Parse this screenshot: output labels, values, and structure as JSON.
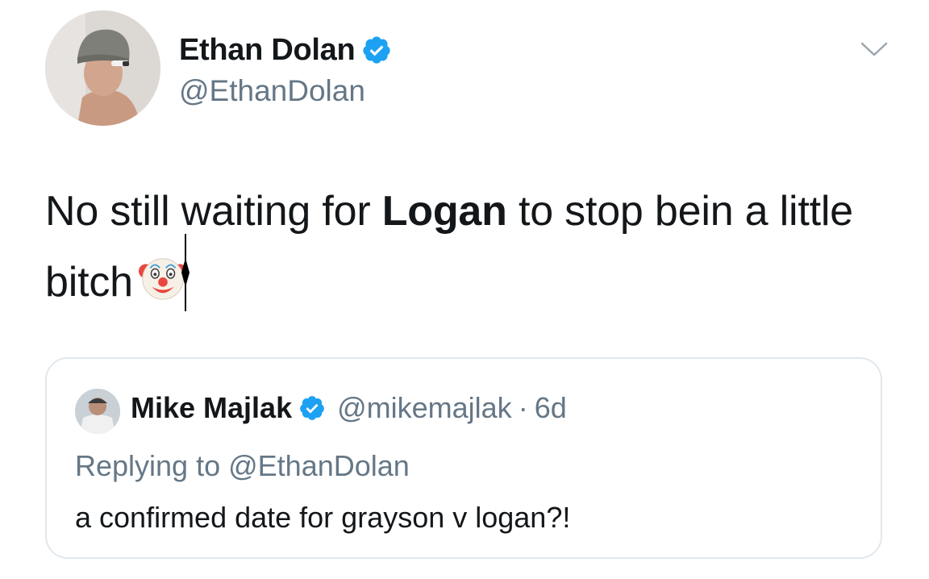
{
  "author": {
    "display_name": "Ethan Dolan",
    "handle": "@EthanDolan",
    "verified": true,
    "avatar_icon": "avatar-photo"
  },
  "menu": {
    "icon": "chevron-down-icon"
  },
  "tweet": {
    "text_before": "No still waiting for ",
    "text_bold": "Logan",
    "text_after": " to stop bein a little bitch",
    "emoji": "clown-face-icon"
  },
  "quoted": {
    "display_name": "Mike Majlak",
    "handle": "@mikemajlak",
    "separator": "·",
    "time": "6d",
    "replying_to": "Replying to @EthanDolan",
    "text": "a confirmed date for grayson v logan?!",
    "verified": true
  },
  "colors": {
    "primary_text": "#14171a",
    "secondary_text": "#657786",
    "verified_blue": "#1da1f2",
    "border": "#e1e8ed"
  }
}
